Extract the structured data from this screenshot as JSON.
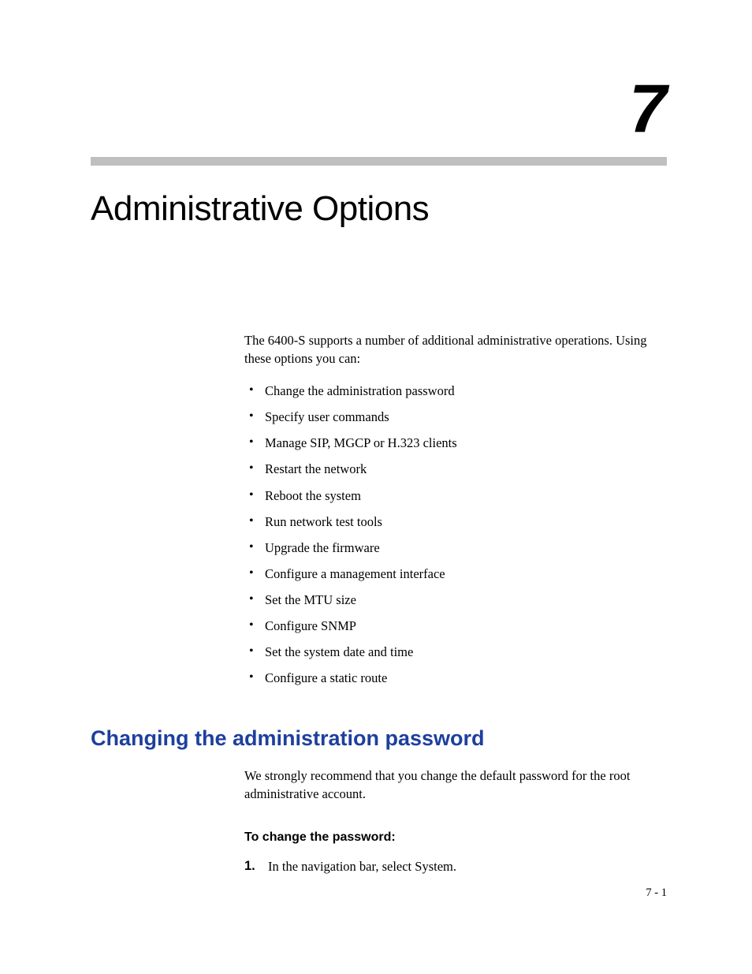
{
  "chapterNumber": "7",
  "chapterTitle": "Administrative Options",
  "introText": "The 6400-S supports a number of additional administrative operations. Using these options you can:",
  "bullets": [
    "Change the administration password",
    "Specify user commands",
    "Manage SIP, MGCP or H.323 clients",
    "Restart the network",
    "Reboot the system",
    "Run network test tools",
    "Upgrade the firmware",
    "Configure a management interface",
    "Set the MTU size",
    "Configure SNMP",
    "Set the system date and time",
    "Configure a static route"
  ],
  "section": {
    "heading": "Changing the administration password",
    "body": "We strongly recommend that you change the default password for the root administrative account.",
    "subHeading": "To change the password:",
    "step1Num": "1.",
    "step1Text": "In the navigation bar, select System."
  },
  "pageFooter": "7 - 1"
}
